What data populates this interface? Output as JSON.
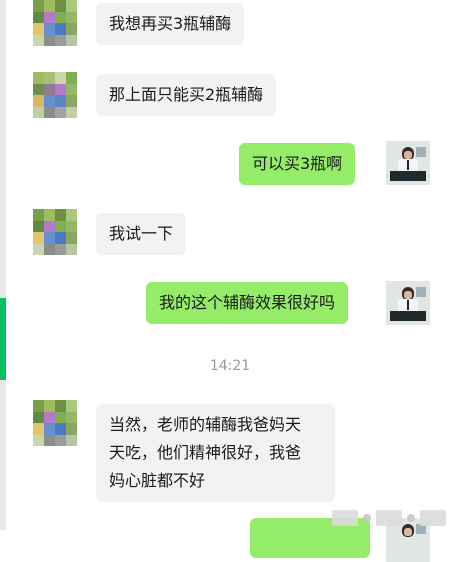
{
  "messages": [
    {
      "side": "in",
      "text": "我想再买3瓶辅酶"
    },
    {
      "side": "in",
      "text": "那上面只能买2瓶辅酶"
    },
    {
      "side": "out",
      "text": "可以买3瓶啊"
    },
    {
      "side": "in",
      "text": "我试一下"
    },
    {
      "side": "out",
      "text": "我的这个辅酶效果很好吗"
    },
    {
      "side": "in",
      "lines": [
        "当然，老师的辅酶我爸妈天",
        "天吃，他们精神很好，我爸",
        "妈心脏都不好"
      ]
    }
  ],
  "timestamp": "14:21",
  "colors": {
    "incoming_bubble": "#f2f2f2",
    "outgoing_bubble": "#95ec69",
    "accent": "#07c160"
  },
  "icons": {
    "contact_avatar": "pixelated-avatar",
    "self_avatar": "man-at-desk-photo"
  }
}
